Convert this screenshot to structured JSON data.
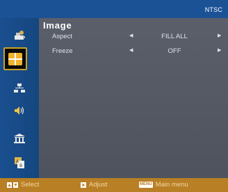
{
  "system": {
    "label": "NTSC"
  },
  "sidebar": {
    "items": [
      {
        "name": "image-settings",
        "icon": "camera-icon",
        "active": false
      },
      {
        "name": "image",
        "icon": "grid-image-icon",
        "active": true
      },
      {
        "name": "display",
        "icon": "network-icon",
        "active": false
      },
      {
        "name": "audio",
        "icon": "speaker-icon",
        "active": false
      },
      {
        "name": "setup",
        "icon": "building-icon",
        "active": false
      },
      {
        "name": "language",
        "icon": "language-icon",
        "active": false
      }
    ]
  },
  "page": {
    "title": "Image",
    "rows": [
      {
        "label": "Aspect",
        "value": "FILL ALL"
      },
      {
        "label": "Freeze",
        "value": "OFF"
      }
    ]
  },
  "footer": {
    "select_label": "Select",
    "adjust_label": "Adjust",
    "menu_key": "MENU",
    "menu_label": "Main menu"
  },
  "colors": {
    "accent": "#c9a228",
    "footer": "#b87f25",
    "sidebar": "#1a4f8f",
    "content": "#555a65"
  }
}
